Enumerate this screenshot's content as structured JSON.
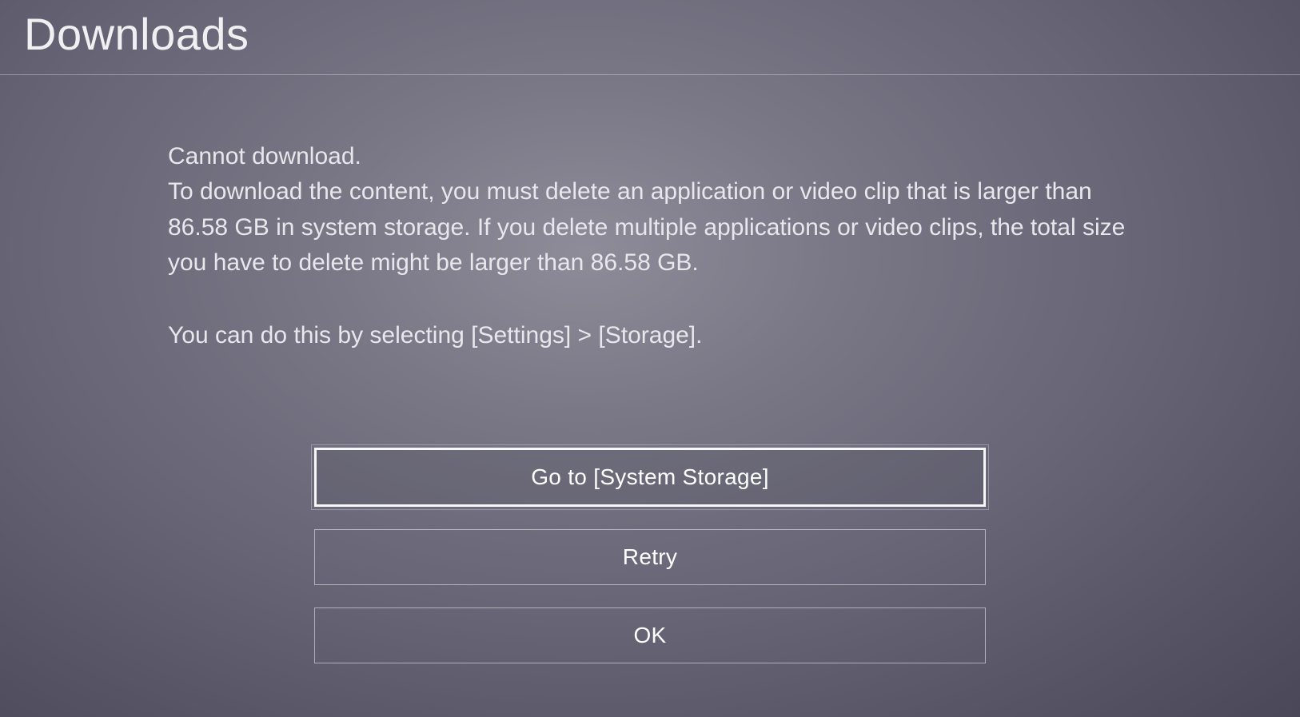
{
  "header": {
    "title": "Downloads"
  },
  "message": {
    "line1": "Cannot download.",
    "body": "To download the content, you must delete an application or video clip that is larger than 86.58 GB in system storage. If you delete multiple applications or video clips, the total size you have to delete might be larger than 86.58 GB.",
    "instruction": "You can do this by selecting [Settings] > [Storage]."
  },
  "buttons": {
    "system_storage": "Go to [System Storage]",
    "retry": "Retry",
    "ok": "OK"
  }
}
